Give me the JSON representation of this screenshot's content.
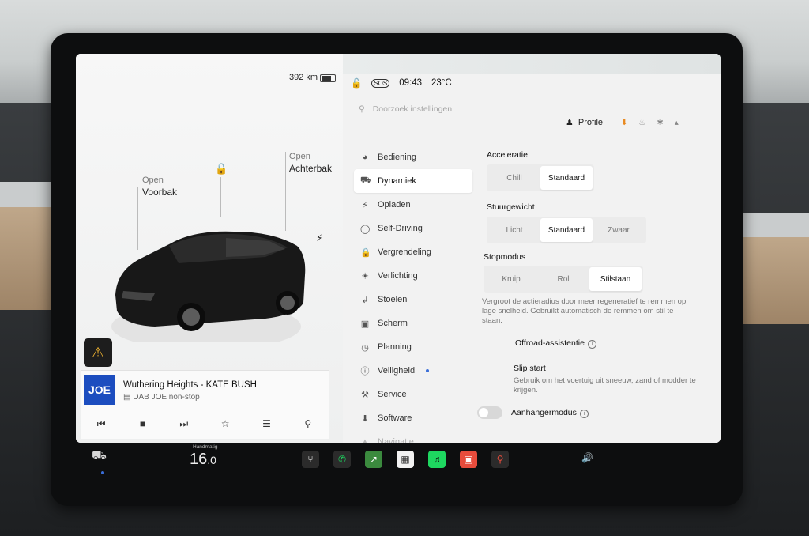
{
  "status": {
    "range": "392 km",
    "battery_fraction": 0.75,
    "time": "09:43",
    "temperature": "23°C",
    "sos": "SOS"
  },
  "car_view": {
    "front_trunk_state": "Open",
    "front_trunk_label": "Voorbak",
    "rear_trunk_state": "Open",
    "rear_trunk_label": "Achterbak"
  },
  "media": {
    "station_logo": "JOE",
    "track": "Wuthering Heights - KATE BUSH",
    "station": "DAB JOE non-stop"
  },
  "search": {
    "placeholder": "Doorzoek instellingen"
  },
  "header": {
    "profile_label": "Profile"
  },
  "menu": [
    {
      "label": "Bediening",
      "icon": "toggle-icon"
    },
    {
      "label": "Dynamiek",
      "icon": "car-icon"
    },
    {
      "label": "Opladen",
      "icon": "bolt-icon"
    },
    {
      "label": "Self-Driving",
      "icon": "steering-wheel-icon"
    },
    {
      "label": "Vergrendeling",
      "icon": "lock-icon"
    },
    {
      "label": "Verlichting",
      "icon": "sun-icon"
    },
    {
      "label": "Stoelen",
      "icon": "seat-icon"
    },
    {
      "label": "Scherm",
      "icon": "screen-icon"
    },
    {
      "label": "Planning",
      "icon": "clock-icon"
    },
    {
      "label": "Veiligheid",
      "icon": "info-circle-icon"
    },
    {
      "label": "Service",
      "icon": "wrench-icon"
    },
    {
      "label": "Software",
      "icon": "download-icon"
    },
    {
      "label": "Navigatie",
      "icon": "navigation-icon"
    }
  ],
  "settings": {
    "acceleration": {
      "title": "Acceleratie",
      "options": [
        "Chill",
        "Standaard"
      ],
      "selected": "Standaard"
    },
    "steering": {
      "title": "Stuurgewicht",
      "options": [
        "Licht",
        "Standaard",
        "Zwaar"
      ],
      "selected": "Standaard"
    },
    "stop_mode": {
      "title": "Stopmodus",
      "options": [
        "Kruip",
        "Rol",
        "Stilstaan"
      ],
      "selected": "Stilstaan",
      "description": "Vergroot de actieradius door meer regeneratief te remmen op lage snelheid. Gebruikt automatisch de remmen om stil te staan."
    },
    "offroad": {
      "title": "Offroad-assistentie"
    },
    "slip_start": {
      "title": "Slip start",
      "description": "Gebruik om het voertuig uit sneeuw, zand of modder te krijgen."
    },
    "trailer": {
      "title": "Aanhangermodus",
      "enabled": false
    }
  },
  "dock": {
    "climate_mode": "Handmatig",
    "climate_temp": "16",
    "climate_temp_decimal": ".0",
    "apps": [
      {
        "name": "wiper-icon",
        "color": "#2b2b2b"
      },
      {
        "name": "phone-icon",
        "color": "#2b2b2b"
      },
      {
        "name": "energy-icon",
        "color": "#3b8a3e"
      },
      {
        "name": "calendar-icon",
        "color": "#f2f2f2"
      },
      {
        "name": "spotify-icon",
        "color": "#1ed760"
      },
      {
        "name": "toybox-icon",
        "color": "#e74c3c"
      },
      {
        "name": "joystick-icon",
        "color": "#2b2b2b"
      }
    ]
  }
}
